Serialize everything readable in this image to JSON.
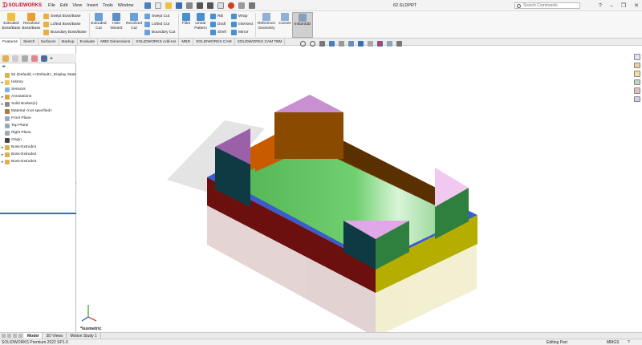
{
  "app": {
    "brand": "SOLIDWORKS",
    "document_title": "62.SLDPRT",
    "menu": [
      "File",
      "Edit",
      "View",
      "Insert",
      "Tools",
      "Window"
    ],
    "search_placeholder": "Search Commands"
  },
  "ribbon": {
    "extruded_boss": "Extruded Boss/Base",
    "revolved_boss": "Revolved Boss/Base",
    "swept_boss": "Swept Boss/Base",
    "lofted_boss": "Lofted Boss/Base",
    "boundary_boss": "Boundary Boss/Base",
    "extruded_cut": "Extruded Cut",
    "hole_wizard": "Hole Wizard",
    "revolved_cut": "Revolved Cut",
    "swept_cut": "Swept Cut",
    "lofted_cut": "Lofted Cut",
    "boundary_cut": "Boundary Cut",
    "fillet": "Fillet",
    "linear_pattern": "Linear Pattern",
    "rib": "Rib",
    "draft": "Draft",
    "shell": "Shell",
    "wrap": "Wrap",
    "intersect": "Intersect",
    "mirror": "Mirror",
    "reference_geometry": "Reference Geometry",
    "curves": "Curves",
    "instant3d": "Instant3D"
  },
  "command_tabs": [
    "Features",
    "Sketch",
    "Surfaces",
    "Markup",
    "Evaluate",
    "MBD Dimensions",
    "SOLIDWORKS Add-Ins",
    "MBD",
    "SOLIDWORKS CAM",
    "SOLIDWORKS CAM TBM"
  ],
  "active_command_tab": "Features",
  "feature_tree": {
    "root": "62 (Default) <<Default>_Display State",
    "items": [
      {
        "label": "History",
        "expander": "▸",
        "color": "#f0c05a"
      },
      {
        "label": "Sensors",
        "expander": "",
        "color": "#7fb2e5"
      },
      {
        "label": "Annotations",
        "expander": "▸",
        "color": "#e0a040"
      },
      {
        "label": "Solid Bodies(1)",
        "expander": "▸",
        "color": "#8a8a8a"
      },
      {
        "label": "Material <not specified>",
        "expander": "",
        "color": "#b07840"
      },
      {
        "label": "Front Plane",
        "expander": "",
        "color": "#9ab"
      },
      {
        "label": "Top Plane",
        "expander": "",
        "color": "#9ab"
      },
      {
        "label": "Right Plane",
        "expander": "",
        "color": "#9ab"
      },
      {
        "label": "Origin",
        "expander": "",
        "color": "#444"
      },
      {
        "label": "Boss-Extrude1",
        "expander": "▸",
        "color": "#e0b050"
      },
      {
        "label": "Boss-Extrude2",
        "expander": "▸",
        "color": "#e0b050"
      },
      {
        "label": "Boss-Extrude3",
        "expander": "▸",
        "color": "#e0b050"
      }
    ]
  },
  "viewport": {
    "view_orientation": "*Isometric",
    "colors": {
      "base_top": "#3a5ccc",
      "base_left": "#6b0f0f",
      "base_right": "#b5ad00",
      "floor": "#4fb04f",
      "wall_dark": "#6b3a00",
      "wall_orange": "#c85a00",
      "block_brown": "#8a4a00",
      "triangle_pink": "#c890d0",
      "teal": "#0e3a44",
      "green_block": "#2f7f3f"
    }
  },
  "bottom_tabs": [
    "Model",
    "3D Views",
    "Motion Study 1"
  ],
  "active_bottom_tab": "Model",
  "status": {
    "version": "SOLIDWORKS Premium 2022 SP1.0",
    "mode": "Editing Part",
    "units": "MMGS"
  }
}
